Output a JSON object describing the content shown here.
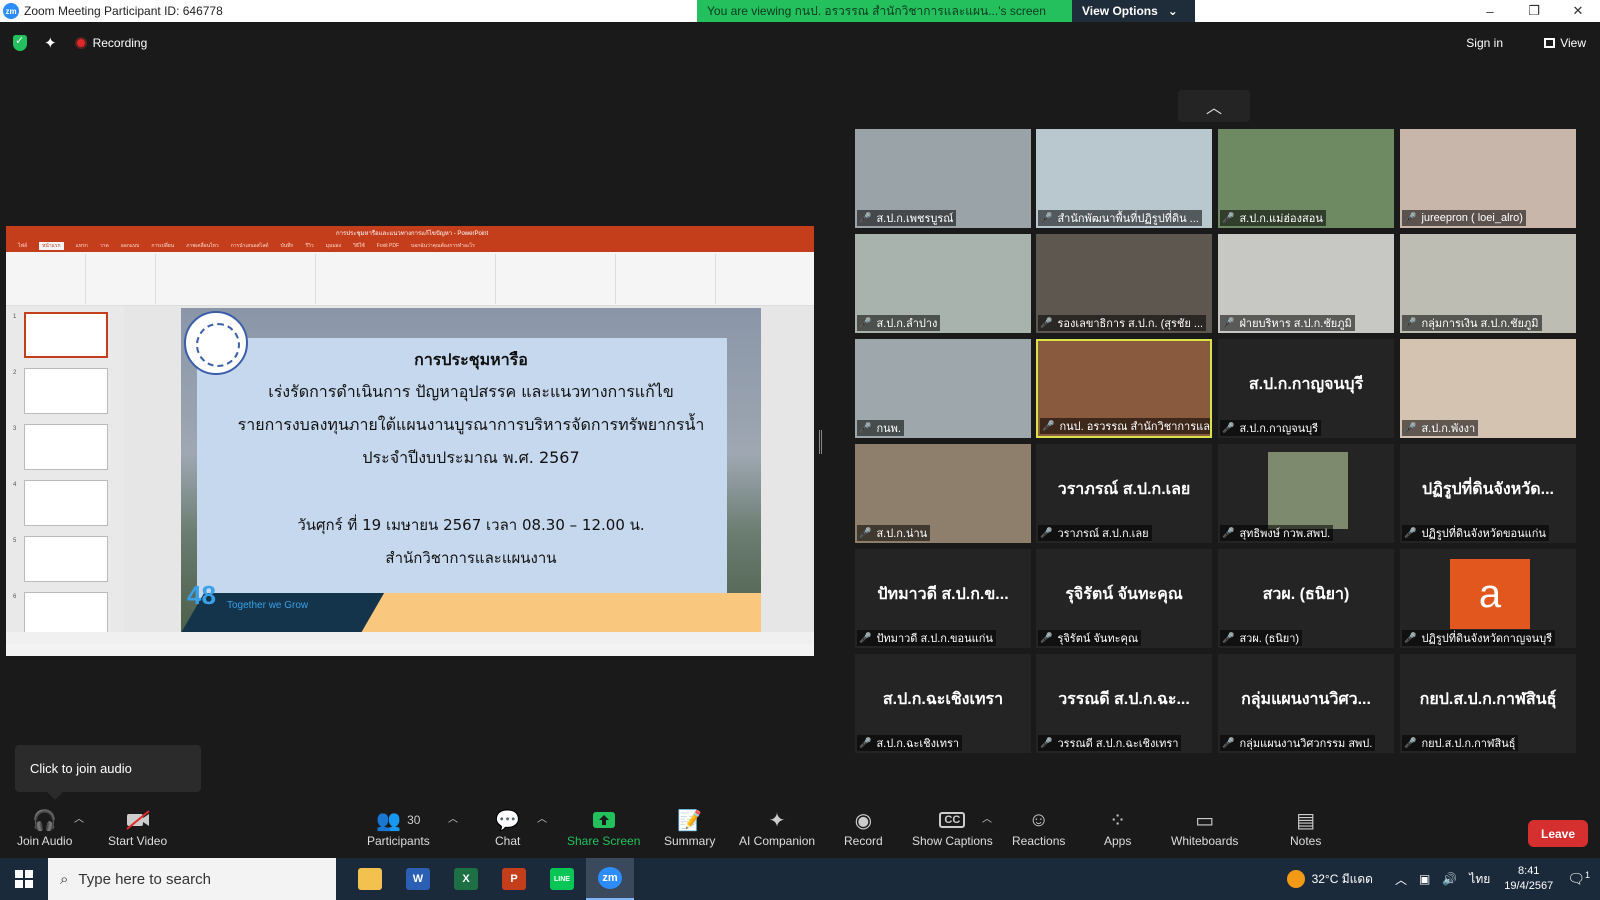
{
  "window": {
    "title": "Zoom Meeting Participant ID: 646778",
    "logo": "zm",
    "controls": [
      "–",
      "❐",
      "✕"
    ]
  },
  "banner": {
    "message": "You are viewing กนป. อรวรรณ สำนักวิชาการและแผน...'s screen",
    "view_options": "View Options"
  },
  "status": {
    "recording": "Recording",
    "sign_in": "Sign in",
    "view": "View"
  },
  "shared_slide": {
    "line1": "การประชุมหารือ",
    "line2": "เร่งรัดการดำเนินการ ปัญหาอุปสรรค และแนวทางการแก้ไข",
    "line3": "รายการงบลงทุนภายใต้แผนงานบูรณาการบริหารจัดการทรัพยากรน้ำ",
    "line4": "ประจำปีงบประมาณ พ.ศ. 2567",
    "date": "วันศุกร์ ที่ 19 เมษายน  2567  เวลา 08.30 – 12.00 น.",
    "org": "สำนักวิชาการและแผนงาน",
    "tagline": "Together we Grow",
    "logo_text": "48"
  },
  "powerpoint": {
    "title": "การประชุมหารือและแนวทางการแก้ไขปัญหา - PowerPoint",
    "tabs": [
      "ไฟล์",
      "หน้าแรก",
      "แทรก",
      "วาด",
      "ออกแบบ",
      "การเปลี่ยน",
      "ภาพเคลื่อนไหว",
      "การนำเสนอสไลด์",
      "บันทึก",
      "รีวิว",
      "มุมมอง",
      "วิธีใช้",
      "Foxit PDF",
      "บอกฉันว่าคุณต้องการทำอะไร"
    ],
    "thumb_numbers": [
      "1",
      "2",
      "3",
      "4",
      "5",
      "6"
    ]
  },
  "participants": [
    {
      "label": "ส.ป.ก.เพชรบูรณ์",
      "video": true,
      "color": "#9aa3a8"
    },
    {
      "label": "สำนักพัฒนาพื้นที่ปฏิรูปที่ดิน ...",
      "video": true,
      "color": "#b9c7cf"
    },
    {
      "label": "ส.ป.ก.แม่ฮ่องสอน",
      "video": true,
      "color": "#6e8a62"
    },
    {
      "label": "jureepron ( loei_alro)",
      "video": true,
      "color": "#c9b6aa"
    },
    {
      "label": "ส.ป.ก.ลำปาง",
      "video": true,
      "color": "#a8b3ad"
    },
    {
      "label": "รองเลขาธิการ ส.ป.ก. (สุรชัย ...",
      "video": true,
      "color": "#5d5750"
    },
    {
      "label": "ฝ่ายบริหาร ส.ป.ก.ชัยภูมิ",
      "video": true,
      "color": "#c7c7c4"
    },
    {
      "label": "กลุ่มการเงิน ส.ป.ก.ชัยภูมิ",
      "video": true,
      "color": "#bdbdb3"
    },
    {
      "label": "กนพ.",
      "video": true,
      "color": "#9ea8ac"
    },
    {
      "label": "กนป. อรวรรณ สำนักวิชาการและ...",
      "video": true,
      "color": "#8a5a3e",
      "active": true
    },
    {
      "label": "ส.ป.ก.กาญจนบุรี",
      "name": "ส.ป.ก.กาญจนบุรี",
      "video": false
    },
    {
      "label": "ส.ป.ก.พังงา",
      "video": true,
      "color": "#d5c3b1"
    },
    {
      "label": "ส.ป.ก.น่าน",
      "video": true,
      "color": "#8d7f6c"
    },
    {
      "label": "วราภรณ์ ส.ป.ก.เลย",
      "name": "วราภรณ์ ส.ป.ก.เลย",
      "video": false
    },
    {
      "label": "สุทธิพงษ์ กวพ.สพป.",
      "video": true,
      "color": "#7d8a6d",
      "small_video": true
    },
    {
      "label": "ปฏิรูปที่ดินจังหวัดขอนแก่น",
      "name": "ปฏิรูปที่ดินจังหวัด...",
      "video": false
    },
    {
      "label": "ปัทมาวดี ส.ป.ก.ขอนแก่น",
      "name": "ปัทมาวดี ส.ป.ก.ข...",
      "video": false
    },
    {
      "label": "รุจิรัตน์ จันทะคุณ",
      "name": "รุจิรัตน์ จันทะคุณ",
      "video": false
    },
    {
      "label": "สวผ. (ธนิยา)",
      "name": "สวผ. (ธนิยา)",
      "video": false
    },
    {
      "label": "ปฏิรูปที่ดินจังหวัดกาญจนบุรี",
      "avatar": "a",
      "video": false
    },
    {
      "label": "ส.ป.ก.ฉะเชิงเทรา",
      "name": "ส.ป.ก.ฉะเชิงเทรา",
      "video": false
    },
    {
      "label": "วรรณดี ส.ป.ก.ฉะเชิงเทรา",
      "name": "วรรณดี ส.ป.ก.ฉะ...",
      "video": false
    },
    {
      "label": "กลุ่มแผนงานวิศวกรรม สพป.",
      "name": "กลุ่มแผนงานวิศว...",
      "video": false
    },
    {
      "label": "กยป.ส.ป.ก.กาฬสินธุ์",
      "name": "กยป.ส.ป.ก.กาฬสินธุ์",
      "video": false
    }
  ],
  "tooltip": "Click to join audio",
  "toolbar": {
    "join_audio": "Join Audio",
    "start_video": "Start Video",
    "participants": "Participants",
    "participants_count": "30",
    "chat": "Chat",
    "share_screen": "Share Screen",
    "summary": "Summary",
    "ai_companion": "AI Companion",
    "record": "Record",
    "show_captions": "Show Captions",
    "reactions": "Reactions",
    "apps": "Apps",
    "whiteboards": "Whiteboards",
    "notes": "Notes",
    "leave": "Leave",
    "captions_icon": "CC"
  },
  "taskbar": {
    "search_placeholder": "Type here to search",
    "apps": [
      "file-explorer",
      "word",
      "excel",
      "powerpoint",
      "line",
      "zoom"
    ],
    "app_letters": {
      "word": "W",
      "excel": "X",
      "powerpoint": "P",
      "line": "LINE",
      "zoom": "zm"
    },
    "weather": "32°C  มีแดด",
    "language": "ไทย",
    "time": "8:41",
    "date": "19/4/2567",
    "notifications": "1"
  }
}
